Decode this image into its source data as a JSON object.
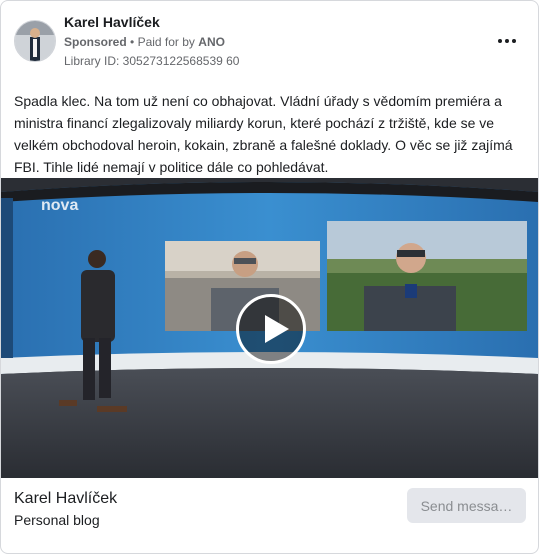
{
  "ad": {
    "page_name": "Karel Havlíček",
    "sponsored_label": "Sponsored",
    "paid_for_prefix": "Paid for by",
    "paid_for_by": "ANO",
    "library_id": "Library ID: 305273122568539 60",
    "body_text": "Spadla klec. Na tom už není co obhajovat. Vládní úřady s vědomím premiéra a ministra financí zlegalizovaly miliardy korun, které pochází z tržiště, kde se ve velkém obchodoval heroin, kokain, zbraně a falešné doklady. O věc se již zajímá FBI. Tihle lidé nemají v politice dále co pohledávat."
  },
  "video": {
    "channel_logo_text": "nova",
    "play_icon": "play-icon"
  },
  "footer": {
    "name": "Karel Havlíček",
    "subtitle": "Personal blog",
    "button_label": "Send messa…"
  },
  "icons": {
    "more": "more-horizontal-icon"
  }
}
